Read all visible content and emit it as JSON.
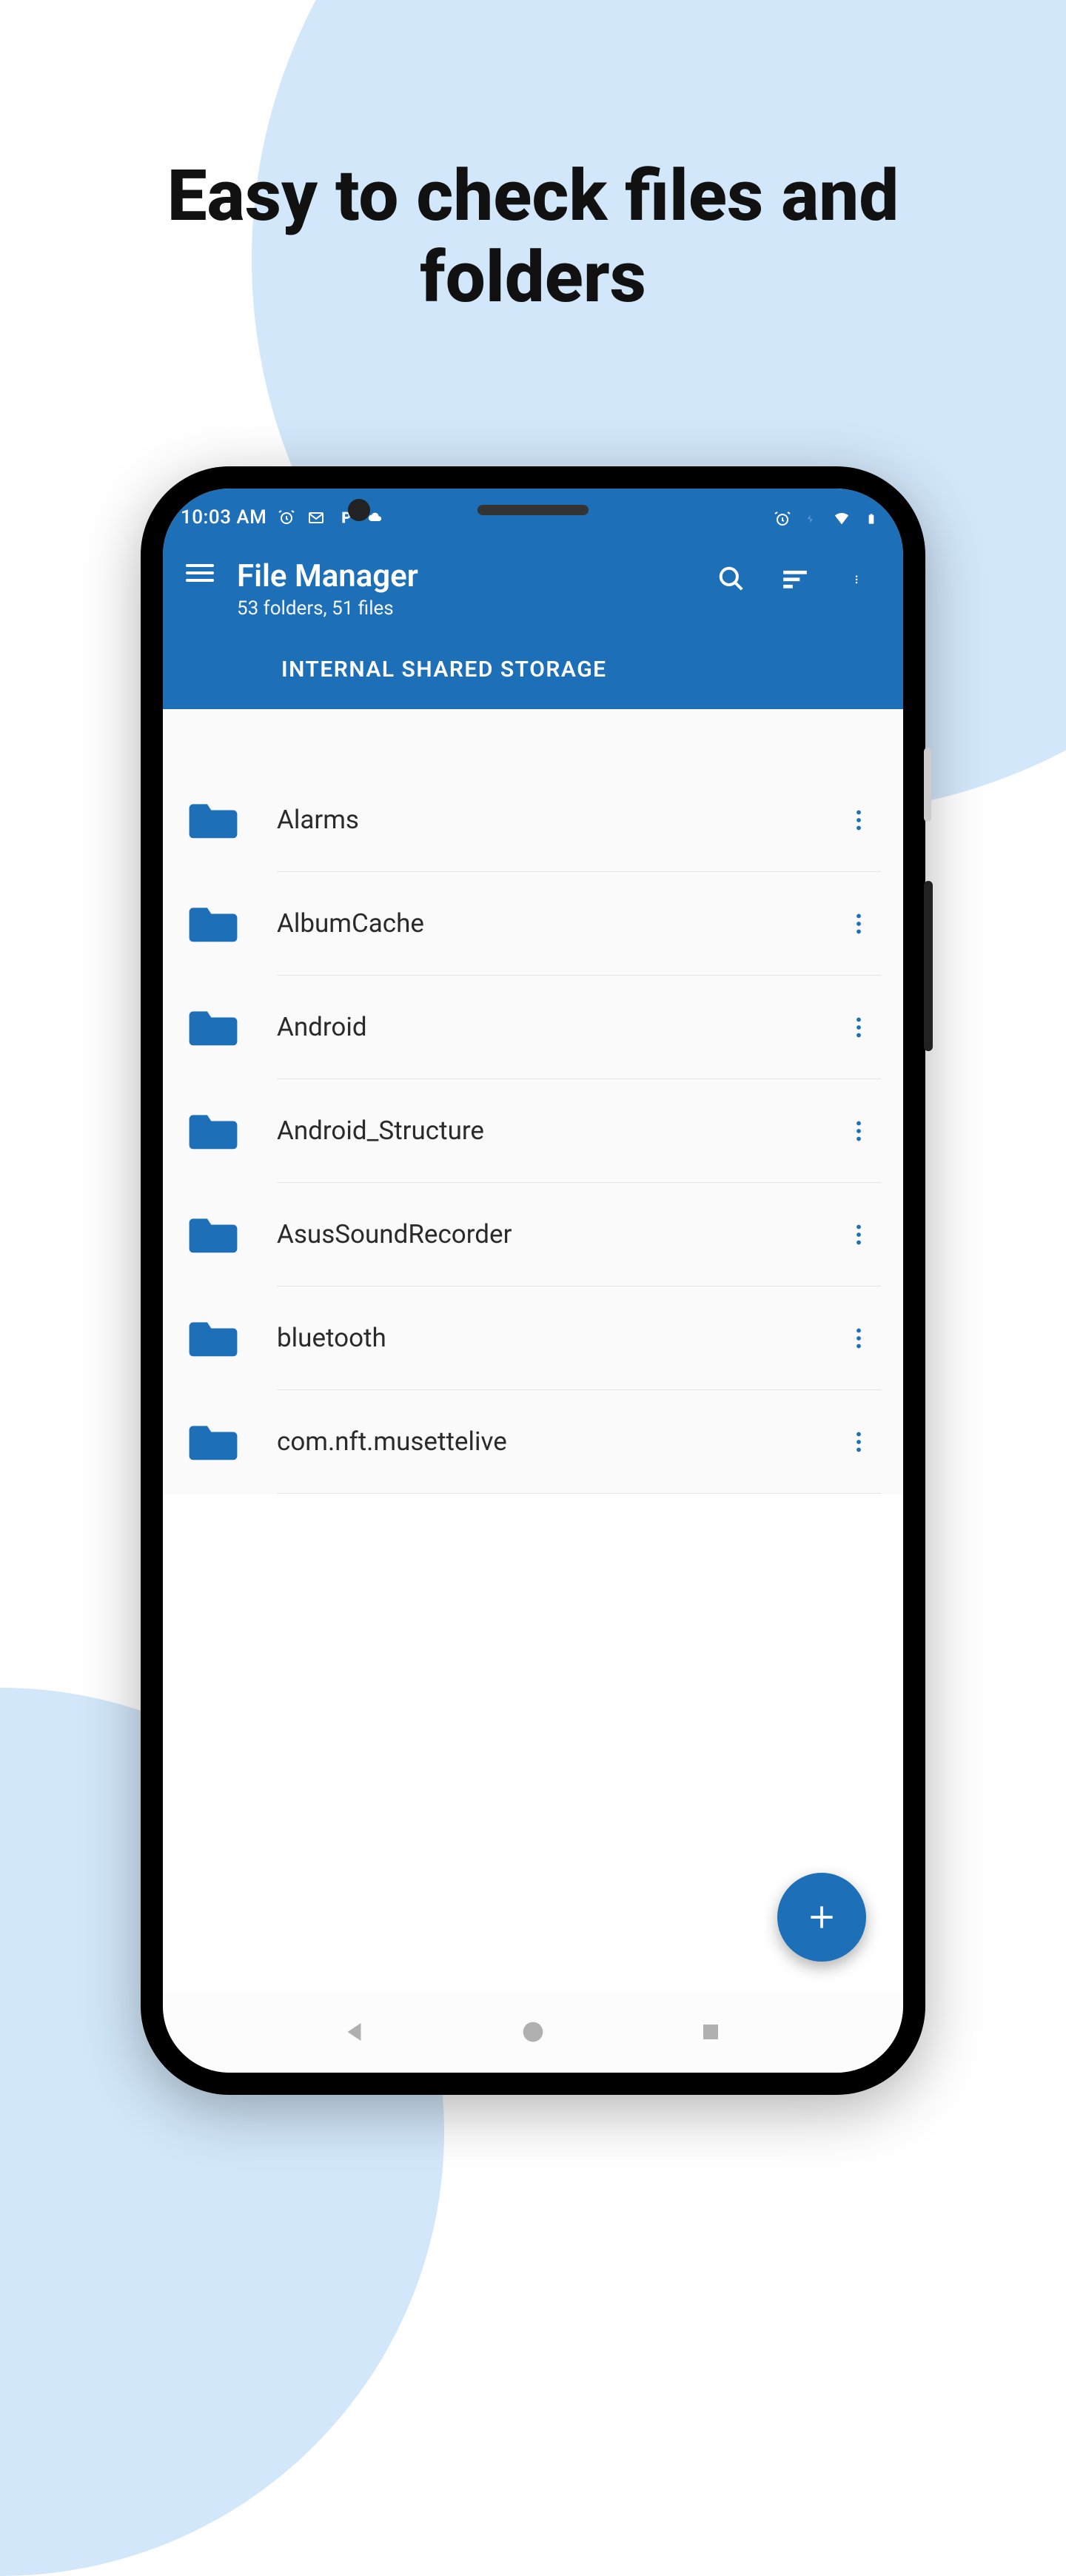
{
  "marketing": {
    "headline_line1": "Easy to check files and",
    "headline_line2": "folders"
  },
  "status_bar": {
    "time": "10:03 AM"
  },
  "app_bar": {
    "title": "File Manager",
    "subtitle": "53 folders, 51 files"
  },
  "breadcrumb": {
    "label": "INTERNAL SHARED STORAGE"
  },
  "folders": [
    {
      "name": "Alarms"
    },
    {
      "name": "AlbumCache"
    },
    {
      "name": "Android"
    },
    {
      "name": "Android_Structure"
    },
    {
      "name": "AsusSoundRecorder"
    },
    {
      "name": "bluetooth"
    },
    {
      "name": "com.nft.musettelive"
    }
  ],
  "colors": {
    "primary": "#1d6fb8",
    "bg_blob": "#d2e7fa",
    "folder": "#1d6fb8"
  }
}
